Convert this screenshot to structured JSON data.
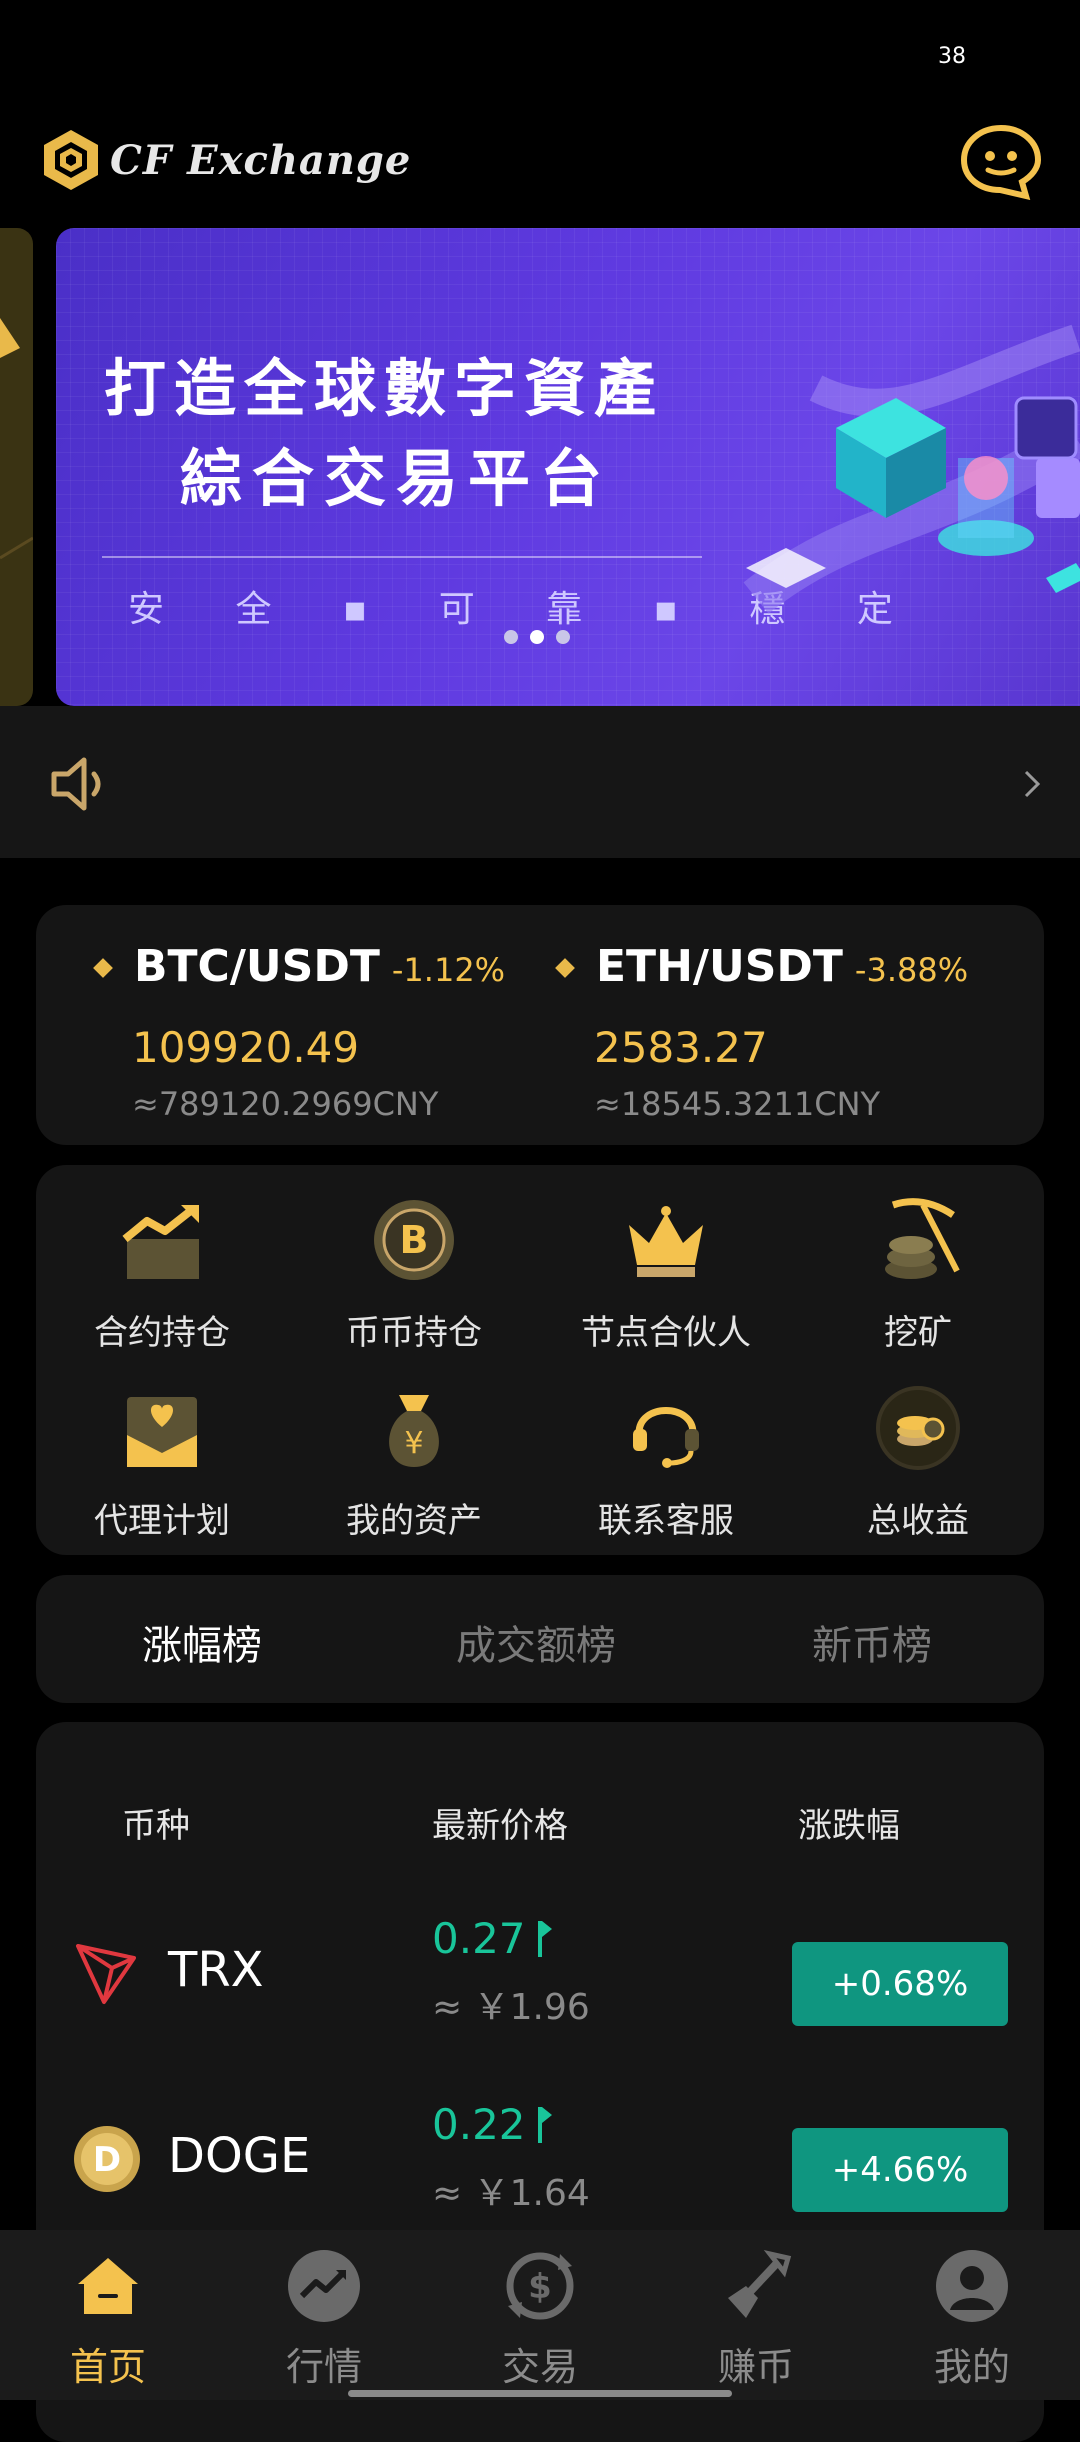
{
  "status": {
    "battery": "38"
  },
  "header": {
    "brand": "CF Exchange"
  },
  "banner": {
    "line1": "打造全球數字資產",
    "line2": "綜合交易平台",
    "line3": "安 全 ▪ 可 靠 ▪ 穩 定",
    "slides": 3,
    "active_slide": 2
  },
  "tickers": [
    {
      "pair": "BTC/USDT",
      "change": "-1.12%",
      "price": "109920.49",
      "cny": "≈789120.2969CNY"
    },
    {
      "pair": "ETH/USDT",
      "change": "-3.88%",
      "price": "2583.27",
      "cny": "≈18545.3211CNY"
    }
  ],
  "menu": [
    {
      "label": "合约持仓",
      "icon": "trend-chart-icon"
    },
    {
      "label": "币币持仓",
      "icon": "bitcoin-icon"
    },
    {
      "label": "节点合伙人",
      "icon": "crown-icon"
    },
    {
      "label": "挖矿",
      "icon": "pickaxe-icon"
    },
    {
      "label": "代理计划",
      "icon": "heart-envelope-icon"
    },
    {
      "label": "我的资产",
      "icon": "money-bag-icon"
    },
    {
      "label": "联系客服",
      "icon": "headset-icon"
    },
    {
      "label": "总收益",
      "icon": "coins-icon"
    }
  ],
  "tabs": [
    {
      "label": "涨幅榜",
      "active": true
    },
    {
      "label": "成交额榜",
      "active": false
    },
    {
      "label": "新币榜",
      "active": false
    }
  ],
  "list": {
    "headers": {
      "coin": "币种",
      "price": "最新价格",
      "change": "涨跌幅"
    },
    "rows": [
      {
        "symbol": "TRX",
        "price": "0.27",
        "cny": "≈ ￥1.96",
        "change": "+0.68%",
        "icon": "tron-icon"
      },
      {
        "symbol": "DOGE",
        "price": "0.22",
        "cny": "≈ ￥1.64",
        "change": "+4.66%",
        "icon": "dogecoin-icon"
      }
    ]
  },
  "nav": [
    {
      "label": "首页",
      "icon": "home-icon",
      "active": true
    },
    {
      "label": "行情",
      "icon": "market-trend-icon",
      "active": false
    },
    {
      "label": "交易",
      "icon": "exchange-icon",
      "active": false
    },
    {
      "label": "赚币",
      "icon": "shovel-icon",
      "active": false
    },
    {
      "label": "我的",
      "icon": "profile-icon",
      "active": false
    }
  ],
  "colors": {
    "accent": "#f4c24e",
    "up": "#19c59a",
    "badge_up": "#0f9680",
    "card": "#151515"
  }
}
